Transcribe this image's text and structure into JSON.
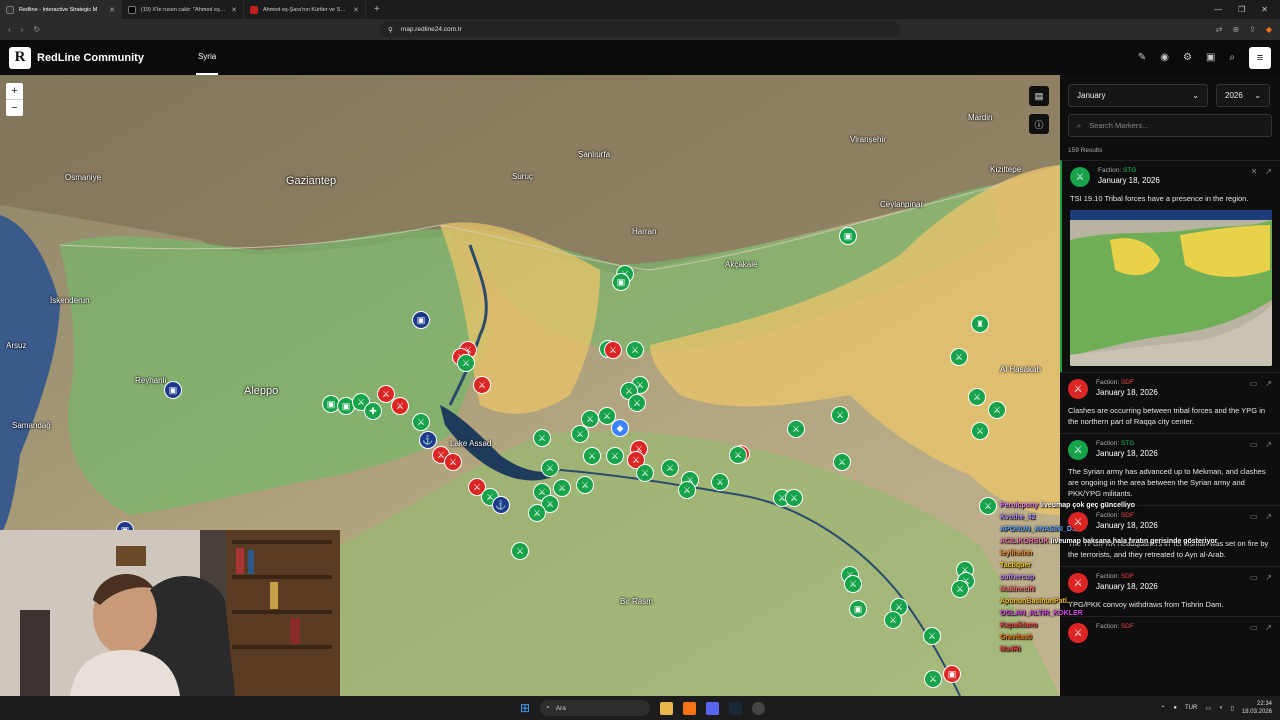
{
  "browser": {
    "tabs": [
      {
        "title": "Redline - Interactive Strategic M",
        "active": true,
        "favicon_color": "#333333"
      },
      {
        "title": "(19) X'te rusen cakir: \"Ahmed eş-Şara",
        "active": false,
        "favicon_color": "#000000"
      },
      {
        "title": "Ahmed eş-Şara'nın Kürtler ve SDG ö",
        "active": false,
        "favicon_color": "#c41e1e"
      }
    ],
    "new_tab_label": "+",
    "url": "map.redline24.com.tr"
  },
  "app": {
    "logo_letter": "R",
    "title": "RedLine Community",
    "nav_tab": "Syria"
  },
  "map": {
    "labels": [
      {
        "text": "Gaziantep",
        "big": true
      },
      {
        "text": "Şanlıurfa",
        "big": false
      },
      {
        "text": "Osmaniye",
        "big": false
      },
      {
        "text": "İskenderun",
        "big": false
      },
      {
        "text": "Aleppo",
        "big": true
      },
      {
        "text": "Harran",
        "big": false
      },
      {
        "text": "Suruç",
        "big": false
      },
      {
        "text": "Viranşehir",
        "big": false
      },
      {
        "text": "Mardin",
        "big": false
      },
      {
        "text": "Kızıltepe",
        "big": false
      },
      {
        "text": "Ceylanpınar",
        "big": false
      },
      {
        "text": "Akçakale",
        "big": false
      },
      {
        "text": "Reyhanlı",
        "big": false
      },
      {
        "text": "Samandağ",
        "big": false
      },
      {
        "text": "Arsuz",
        "big": false
      },
      {
        "text": "Al Hasakah",
        "big": false
      },
      {
        "text": "Lake Assad",
        "big": false
      },
      {
        "text": "Bir Rasm",
        "big": false
      }
    ],
    "zoom_in": "+",
    "zoom_out": "−"
  },
  "panel": {
    "month": "January",
    "year": "2026",
    "search_placeholder": "Search Markers...",
    "results_count": "159 Results",
    "cards": [
      {
        "faction_label": "Faction:",
        "faction": "STG",
        "faction_color": "#22c55e",
        "date": "January 18, 2026",
        "text": "TSI 19.10 Tribal forces have a presence in the region.",
        "has_image": true,
        "icon_color": "#16a34a"
      },
      {
        "faction_label": "Faction:",
        "faction": "SDF",
        "faction_color": "#ef4444",
        "date": "January 18, 2026",
        "text": "Clashes are occurring between tribal forces and the YPG in the northern part of Raqqa city center.",
        "has_image": false,
        "icon_color": "#dc2626"
      },
      {
        "faction_label": "Faction:",
        "faction": "STG",
        "faction_color": "#22c55e",
        "date": "January 18, 2026",
        "text": "The Syrian army has advanced up to Mekman, and clashes are ongoing in the area between the Syrian army and PKK/YPG militants.",
        "has_image": false,
        "icon_color": "#16a34a"
      },
      {
        "faction_label": "Faction:",
        "faction": "SDF",
        "faction_color": "#ef4444",
        "date": "January 18, 2026",
        "text": "The YPG/PKK headquarters in Tel Osman was set on fire by the terrorists, and they retreated to Ayn al-Arab.",
        "has_image": false,
        "icon_color": "#dc2626"
      },
      {
        "faction_label": "Faction:",
        "faction": "SDF",
        "faction_color": "#ef4444",
        "date": "January 18, 2026",
        "text": "YPG/PKK convoy withdraws from Tishrin Dam.",
        "has_image": false,
        "icon_color": "#dc2626"
      },
      {
        "faction_label": "Faction:",
        "faction": "SDF",
        "faction_color": "#ef4444",
        "date": "",
        "text": "",
        "has_image": false,
        "icon_color": "#dc2626"
      }
    ]
  },
  "chat": [
    {
      "user": "Peroicpony",
      "msg": "liveumap çok geç güncelliyo",
      "color": "#e879f9"
    },
    {
      "user": "Kvothe_42",
      "msg": "",
      "color": "#a78bfa"
    },
    {
      "user": "APONUN_ANASINI_D...",
      "msg": "",
      "color": "#60a5fa"
    },
    {
      "user": "ACILIKORSUK",
      "msg": "liveumap baksana hala fıratın gerisinde gösteriyor",
      "color": "#f472b6"
    },
    {
      "user": "leylihelnn",
      "msg": "",
      "color": "#fb923c"
    },
    {
      "user": "Tactiquer",
      "msg": "",
      "color": "#facc15"
    },
    {
      "user": "outhercup",
      "msg": "",
      "color": "#c084fc"
    },
    {
      "user": "MakineciN",
      "msg": "",
      "color": "#f87171"
    },
    {
      "user": "AponunBasinunPatl...",
      "msg": "",
      "color": "#fbbf24"
    },
    {
      "user": "OGLAN_ALTIR_KOKLER",
      "msg": "",
      "color": "#d946ef"
    },
    {
      "user": "Kapaikiano",
      "msg": "",
      "color": "#ef4444"
    },
    {
      "user": "Gravitas0",
      "msg": "",
      "color": "#f97316"
    },
    {
      "user": "Ma4Ri",
      "msg": "",
      "color": "#ef4444"
    }
  ],
  "taskbar": {
    "search_label": "Ara",
    "lang": "TUR",
    "time": "22:34",
    "date": "18.03.2026"
  }
}
